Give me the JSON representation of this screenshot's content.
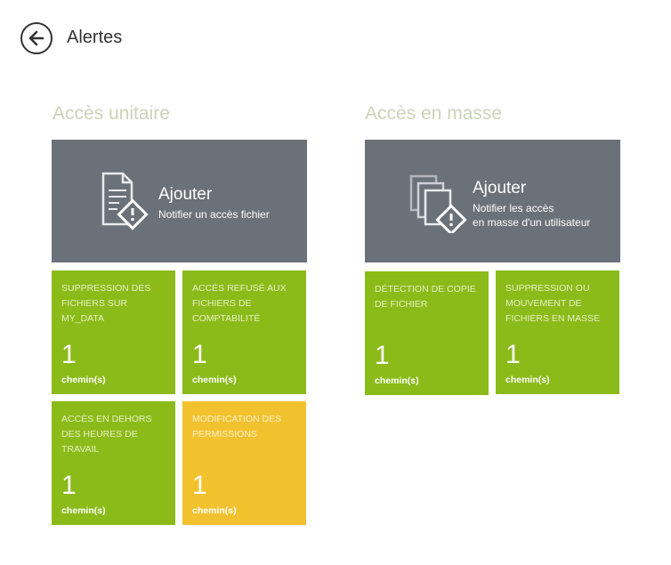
{
  "header": {
    "title": "Alertes",
    "back_icon": "arrow-left-icon"
  },
  "colors": {
    "green": "#8bbb19",
    "yellow": "#f2c12e",
    "gray": "#6b7178",
    "section": "#cdd3b8"
  },
  "sections": [
    {
      "title": "Accès unitaire",
      "add": {
        "title": "Ajouter",
        "subtitle": "Notifier un accès fichier",
        "icon": "file-alert-icon"
      },
      "tiles": [
        {
          "label": "SUPPRESSION DES FICHIERS SUR MY_DATA",
          "count": "1",
          "unit": "chemin(s)",
          "color": "green"
        },
        {
          "label": "ACCÈS REFUSÉ AUX FICHIERS DE COMPTABILITÉ",
          "count": "1",
          "unit": "chemin(s)",
          "color": "green"
        },
        {
          "label": "ACCÈS EN DEHORS DES HEURES DE TRAVAIL",
          "count": "1",
          "unit": "chemin(s)",
          "color": "green"
        },
        {
          "label": "MODIFICATION DES PERMISSIONS",
          "count": "1",
          "unit": "chemin(s)",
          "color": "yellow"
        }
      ]
    },
    {
      "title": "Accès en masse",
      "add": {
        "title": "Ajouter",
        "subtitle_line1": "Notifier les accès",
        "subtitle_line2": "en masse d'un utilisateur",
        "icon": "files-alert-icon"
      },
      "tiles": [
        {
          "label": "DÉTECTION DE COPIE DE FICHIER",
          "count": "1",
          "unit": "chemin(s)",
          "color": "green"
        },
        {
          "label": "SUPPRESSION OU MOUVEMENT DE FICHIERS EN MASSE",
          "count": "1",
          "unit": "chemin(s)",
          "color": "green"
        }
      ]
    }
  ]
}
